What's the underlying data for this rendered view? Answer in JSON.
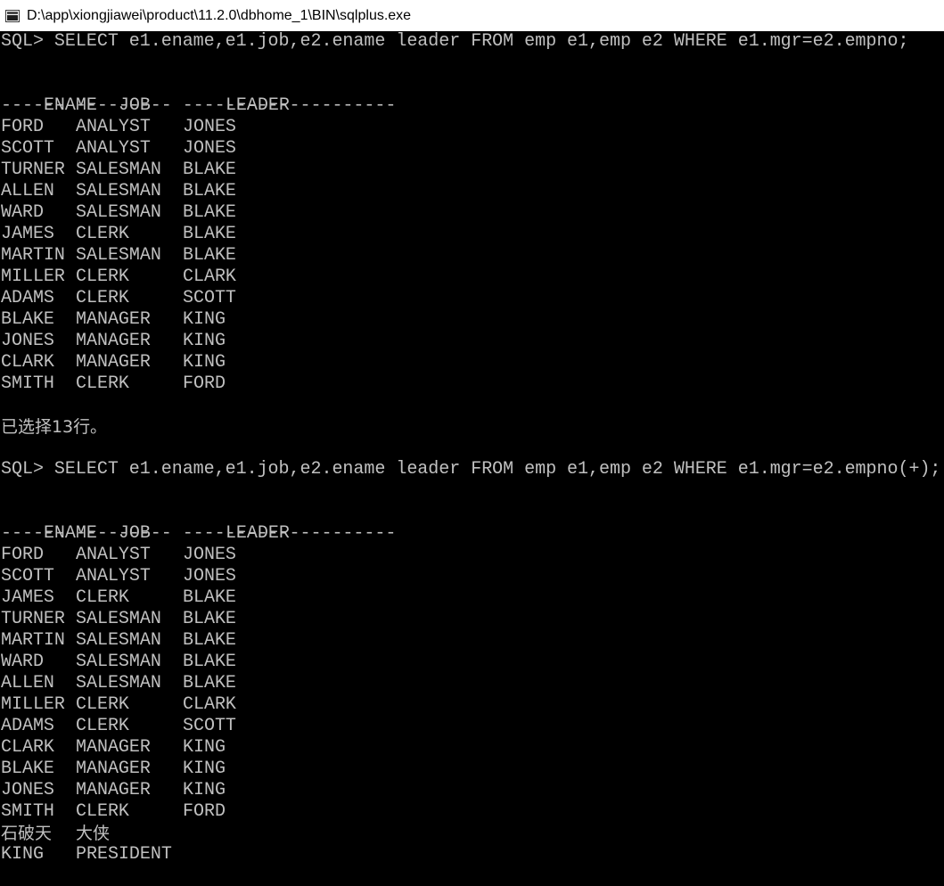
{
  "window": {
    "title": "D:\\app\\xiongjiawei\\product\\11.2.0\\dbhome_1\\BIN\\sqlplus.exe",
    "icon": "console-window-icon"
  },
  "colors": {
    "background": "#000000",
    "text": "#c0c0c0",
    "titlebar": "#ffffff"
  },
  "console": {
    "query1": {
      "command": "SQL> SELECT e1.ename,e1.job,e2.ename leader FROM emp e1,emp e2 WHERE e1.mgr=e2.empno;",
      "headers": [
        "ENAME",
        "JOB",
        "LEADER"
      ],
      "separator": "------ --------- --------------------",
      "rows": [
        [
          "FORD",
          "ANALYST",
          "JONES"
        ],
        [
          "SCOTT",
          "ANALYST",
          "JONES"
        ],
        [
          "TURNER",
          "SALESMAN",
          "BLAKE"
        ],
        [
          "ALLEN",
          "SALESMAN",
          "BLAKE"
        ],
        [
          "WARD",
          "SALESMAN",
          "BLAKE"
        ],
        [
          "JAMES",
          "CLERK",
          "BLAKE"
        ],
        [
          "MARTIN",
          "SALESMAN",
          "BLAKE"
        ],
        [
          "MILLER",
          "CLERK",
          "CLARK"
        ],
        [
          "ADAMS",
          "CLERK",
          "SCOTT"
        ],
        [
          "BLAKE",
          "MANAGER",
          "KING"
        ],
        [
          "JONES",
          "MANAGER",
          "KING"
        ],
        [
          "CLARK",
          "MANAGER",
          "KING"
        ],
        [
          "SMITH",
          "CLERK",
          "FORD"
        ]
      ],
      "footer": "已选择13行。"
    },
    "query2": {
      "command": "SQL> SELECT e1.ename,e1.job,e2.ename leader FROM emp e1,emp e2 WHERE e1.mgr=e2.empno(+);",
      "headers": [
        "ENAME",
        "JOB",
        "LEADER"
      ],
      "separator": "------ --------- --------------------",
      "rows": [
        [
          "FORD",
          "ANALYST",
          "JONES"
        ],
        [
          "SCOTT",
          "ANALYST",
          "JONES"
        ],
        [
          "JAMES",
          "CLERK",
          "BLAKE"
        ],
        [
          "TURNER",
          "SALESMAN",
          "BLAKE"
        ],
        [
          "MARTIN",
          "SALESMAN",
          "BLAKE"
        ],
        [
          "WARD",
          "SALESMAN",
          "BLAKE"
        ],
        [
          "ALLEN",
          "SALESMAN",
          "BLAKE"
        ],
        [
          "MILLER",
          "CLERK",
          "CLARK"
        ],
        [
          "ADAMS",
          "CLERK",
          "SCOTT"
        ],
        [
          "CLARK",
          "MANAGER",
          "KING"
        ],
        [
          "BLAKE",
          "MANAGER",
          "KING"
        ],
        [
          "JONES",
          "MANAGER",
          "KING"
        ],
        [
          "SMITH",
          "CLERK",
          "FORD"
        ],
        [
          "石破天",
          "大侠",
          ""
        ],
        [
          "KING",
          "PRESIDENT",
          ""
        ]
      ]
    }
  }
}
